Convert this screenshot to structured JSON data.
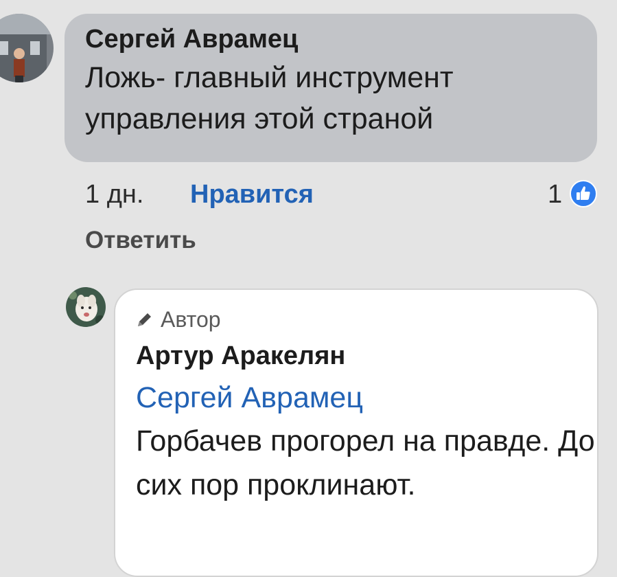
{
  "comment1": {
    "author": "Сергей Аврамец",
    "text": "Ложь- главный инструмент управления этой страной",
    "time": "1 дн.",
    "like_label": "Нравится",
    "reactions_count": "1",
    "reply_label": "Ответить"
  },
  "comment2": {
    "badge": "Автор",
    "author": "Артур Аракелян",
    "mention": "Сергей Аврамец",
    "text": "Горбачев прогорел на правде. До сих пор проклинают."
  },
  "colors": {
    "link_blue": "#2262b5",
    "bubble_gray": "#c2c4c8",
    "background": "#e4e4e4"
  },
  "icons": {
    "reaction": "thumbs-up-icon",
    "badge": "pencil-icon"
  }
}
